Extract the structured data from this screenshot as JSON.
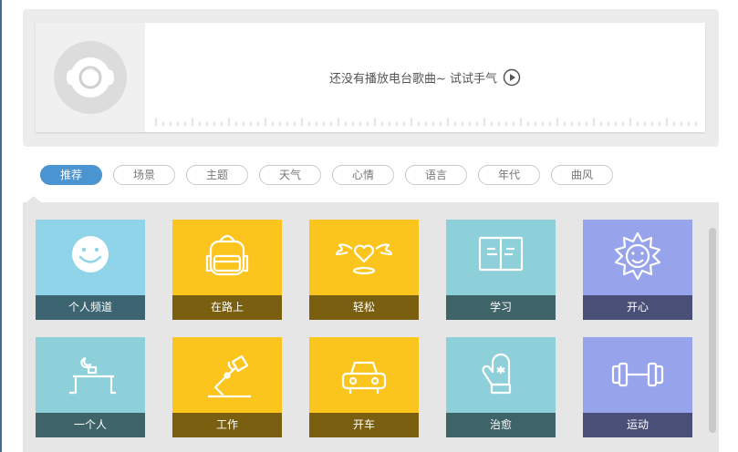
{
  "player": {
    "empty_message": "还没有播放电台歌曲~ 试试手气",
    "cover_icon": "vinyl-disc-icon",
    "play_icon": "circle-play-icon"
  },
  "tabs": [
    {
      "label": "推荐",
      "active": true
    },
    {
      "label": "场景",
      "active": false
    },
    {
      "label": "主题",
      "active": false
    },
    {
      "label": "天气",
      "active": false
    },
    {
      "label": "心情",
      "active": false
    },
    {
      "label": "语言",
      "active": false
    },
    {
      "label": "年代",
      "active": false
    },
    {
      "label": "曲风",
      "active": false
    }
  ],
  "tiles": [
    {
      "label": "个人频道",
      "icon": "smiley-icon",
      "bg": "#8fd4e9",
      "label_bg": "#3c6471"
    },
    {
      "label": "在路上",
      "icon": "backpack-icon",
      "bg": "#fcc51d",
      "label_bg": "#7a5f10"
    },
    {
      "label": "轻松",
      "icon": "winged-heart-icon",
      "bg": "#fcc51d",
      "label_bg": "#7a5f10"
    },
    {
      "label": "学习",
      "icon": "open-book-icon",
      "bg": "#8dd0da",
      "label_bg": "#3e6368"
    },
    {
      "label": "开心",
      "icon": "sun-icon",
      "bg": "#97a3ea",
      "label_bg": "#4a4f77"
    },
    {
      "label": "一个人",
      "icon": "desk-moon-icon",
      "bg": "#8dd0da",
      "label_bg": "#3e6368"
    },
    {
      "label": "工作",
      "icon": "desk-lamp-icon",
      "bg": "#fcc51d",
      "label_bg": "#7a5f10"
    },
    {
      "label": "开车",
      "icon": "car-icon",
      "bg": "#fcc51d",
      "label_bg": "#7a5f10"
    },
    {
      "label": "治愈",
      "icon": "mitten-icon",
      "bg": "#8dd0da",
      "label_bg": "#3e6368"
    },
    {
      "label": "运动",
      "icon": "dumbbell-icon",
      "bg": "#97a3ea",
      "label_bg": "#4a4f77"
    }
  ]
}
